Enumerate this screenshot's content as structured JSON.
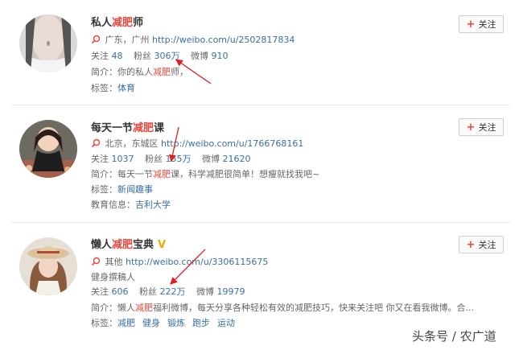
{
  "users": [
    {
      "name_pre": "私人",
      "name_hl": "减肥",
      "name_post": "师",
      "verified": false,
      "location": "广东，广州",
      "url": "http://weibo.com/u/2502817834",
      "follow_label": "关注",
      "following_label": "关注",
      "following": "48",
      "fans_label": "粉丝",
      "fans": "306万",
      "weibo_label": "微博",
      "weibo": "910",
      "intro_label": "简介：",
      "intro_pre": "你的私人",
      "intro_hl": "减肥",
      "intro_post": "师，",
      "tags_label": "标签：",
      "tags": [
        "体育"
      ]
    },
    {
      "name_pre": "每天一节",
      "name_hl": "减肥",
      "name_post": "课",
      "verified": false,
      "location": "北京，东城区",
      "url": "http://weibo.com/u/1766768161",
      "follow_label": "关注",
      "following_label": "关注",
      "following": "1037",
      "fans_label": "粉丝",
      "fans": "155万",
      "weibo_label": "微博",
      "weibo": "21620",
      "intro_label": "简介：",
      "intro_pre": "每天一节",
      "intro_hl": "减肥",
      "intro_post": "课，科学减肥很简单！想瘦就找我吧~",
      "tags_label": "标签：",
      "tags": [
        "新闻趣事"
      ],
      "edu_label": "教育信息：",
      "edu": "吉利大学"
    },
    {
      "name_pre": "懒人",
      "name_hl": "减肥",
      "name_post": "宝典",
      "verified": true,
      "verified_mark": "V",
      "location": "其他",
      "url": "http://weibo.com/u/3306115675",
      "role": "健身撰稿人",
      "follow_label": "关注",
      "following_label": "关注",
      "following": "606",
      "fans_label": "粉丝",
      "fans": "222万",
      "weibo_label": "微博",
      "weibo": "19979",
      "intro_label": "简介：",
      "intro_pre": "懒人",
      "intro_hl": "减肥",
      "intro_post": "福利微博，每天分享各种轻松有效的减肥技巧，快来关注吧 你又在看我微博。合...",
      "tags_label": "标签：",
      "tags": [
        "减肥",
        "健身",
        "锻炼",
        "跑步",
        "运动"
      ]
    }
  ],
  "watermark": "头条号 / 农广道",
  "colors": {
    "highlight": "#e8473c",
    "link": "#3a6ea5",
    "arrow": "#e02020",
    "badge": "#f0a800"
  },
  "icons": {
    "location": "location-pin-icon",
    "plus": "plus-icon",
    "verified": "verified-badge-icon"
  }
}
